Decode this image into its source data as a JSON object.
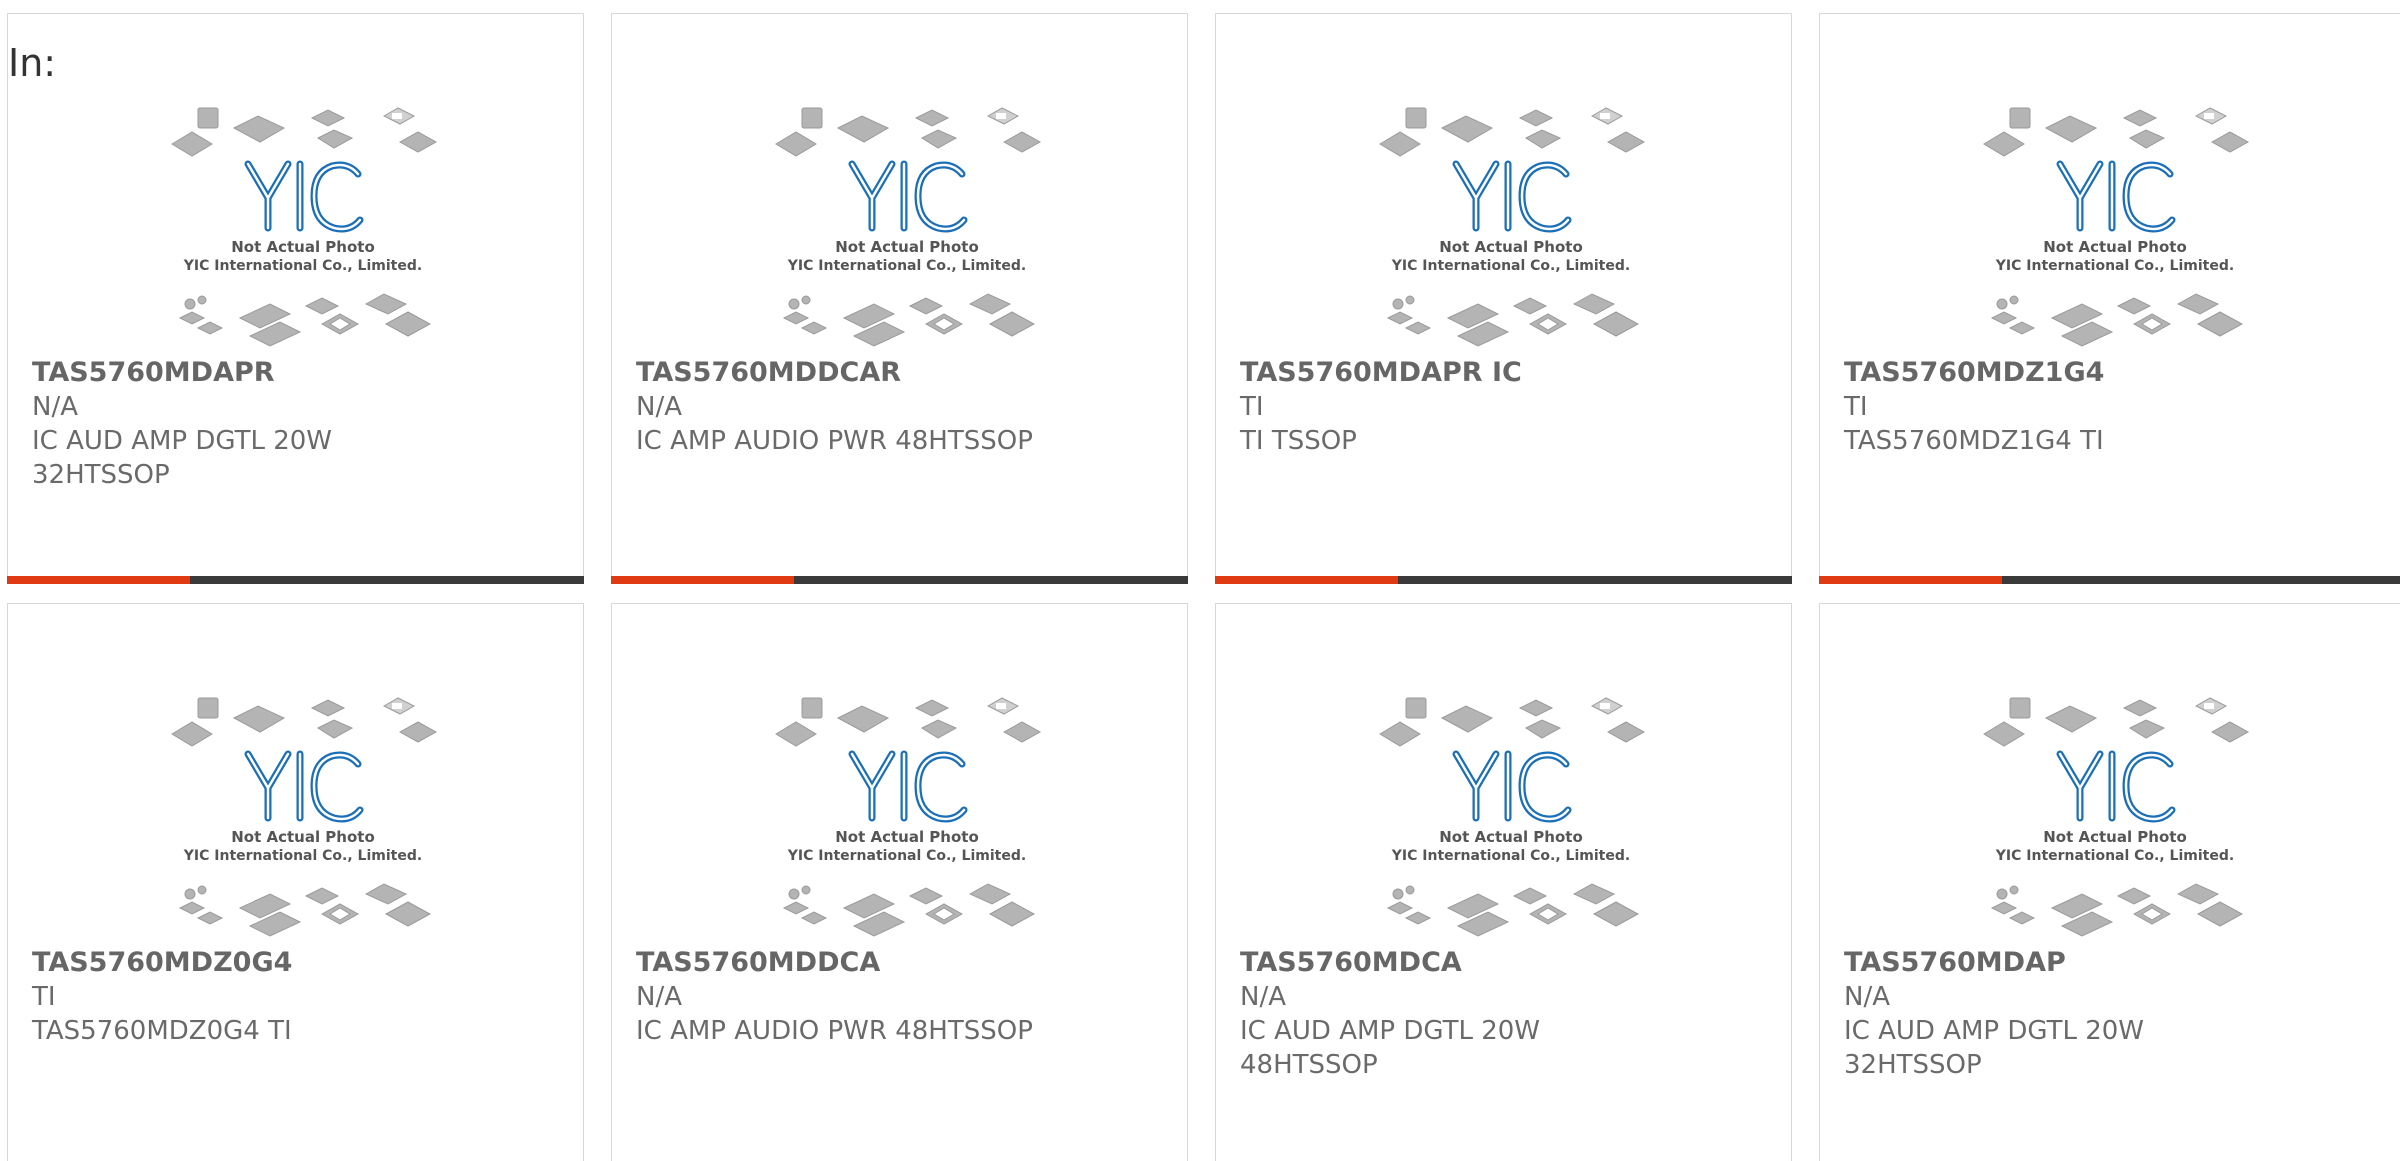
{
  "header": {
    "label": "In:"
  },
  "brand": {
    "logo_text": "YIC",
    "caption_line1": "Not Actual Photo",
    "caption_line2": "YIC International Co., Limited.",
    "logo_color": "#1a6fb8",
    "accent_color": "#e03a12",
    "bar_color": "#3a3a3a"
  },
  "products": [
    {
      "part_number": "TAS5760MDAPR",
      "manufacturer": "N/A",
      "description": "IC AUD AMP DGTL 20W 32HTSSOP"
    },
    {
      "part_number": "TAS5760MDDCAR",
      "manufacturer": "N/A",
      "description": "IC AMP AUDIO PWR 48HTSSOP"
    },
    {
      "part_number": "TAS5760MDAPR IC",
      "manufacturer": "TI",
      "description": "TI TSSOP"
    },
    {
      "part_number": "TAS5760MDZ1G4",
      "manufacturer": "TI",
      "description": "TAS5760MDZ1G4 TI"
    },
    {
      "part_number": "TAS5760MDZ0G4",
      "manufacturer": "TI",
      "description": "TAS5760MDZ0G4 TI"
    },
    {
      "part_number": "TAS5760MDDCA",
      "manufacturer": "N/A",
      "description": "IC AMP AUDIO PWR 48HTSSOP"
    },
    {
      "part_number": "TAS5760MDCA",
      "manufacturer": "N/A",
      "description": "IC AUD AMP DGTL 20W 48HTSSOP"
    },
    {
      "part_number": "TAS5760MDAP",
      "manufacturer": "N/A",
      "description": "IC AUD AMP DGTL 20W 32HTSSOP"
    }
  ]
}
